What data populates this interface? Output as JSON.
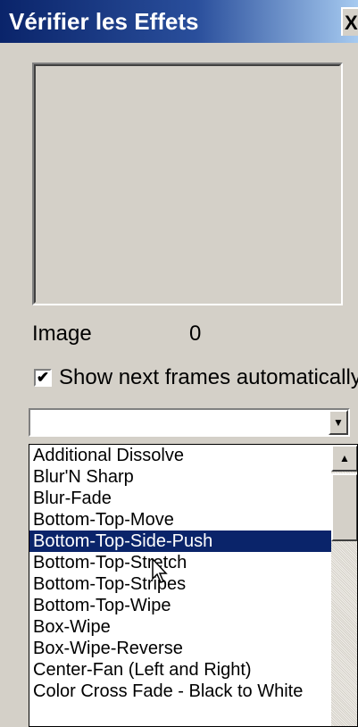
{
  "window": {
    "title": "Vérifier les Effets",
    "close_label": "X"
  },
  "preview": {
    "image_label": "Image",
    "image_value": "0",
    "auto_checkbox": {
      "label": "Show next frames automatically",
      "checked": true,
      "mark": "✔"
    }
  },
  "effect_combo": {
    "value": "",
    "arrow": "▼"
  },
  "effects_list": {
    "scroll_up": "▲",
    "items": [
      "Additional Dissolve",
      "Blur'N Sharp",
      "Blur-Fade",
      "Bottom-Top-Move",
      "Bottom-Top-Side-Push",
      "Bottom-Top-Stretch",
      "Bottom-Top-Stripes",
      "Bottom-Top-Wipe",
      "Box-Wipe",
      "Box-Wipe-Reverse",
      "Center-Fan (Left and Right)",
      "Color Cross Fade - Black to White"
    ],
    "selected_index": 4
  }
}
